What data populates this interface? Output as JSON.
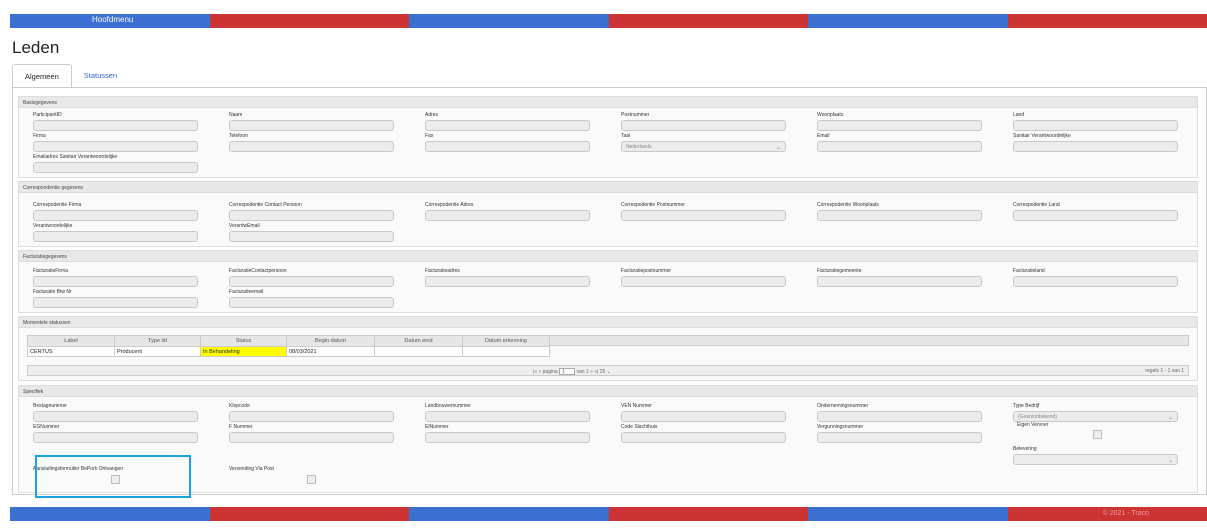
{
  "topbar": {
    "menu_label": "Hoofdmenu",
    "colors": [
      "#3b6fd1",
      "#cc3333"
    ]
  },
  "page": {
    "title": "Leden"
  },
  "tabs": [
    {
      "label": "Algemeen",
      "active": true
    },
    {
      "label": "Statussen",
      "active": false
    }
  ],
  "basis": {
    "header": "Basisgegevens",
    "fields": {
      "participant_id": "ParticipantID",
      "naam": "Naam",
      "adres": "Adres",
      "postnummer": "Postnummer",
      "woonplaats": "Woonplaats",
      "land": "Land",
      "firma": "Firma",
      "telefoon": "Telefoon",
      "fax": "Fax",
      "taal": "Taal",
      "taal_value": "Nederlands",
      "email": "Email",
      "sanitair": "Sanitair Verantwoordelijke",
      "emailadres_sanitair": "Emailadres Sanitair Verantwoordelijke"
    }
  },
  "correspondentie": {
    "header": "Correspondentie gegevens",
    "fields": {
      "firma": "Correspodentie Firma",
      "contact": "Correspodentie Contact Persoon",
      "adres": "Correspodentie Adres",
      "postnummer": "Correspodentie Postnummer",
      "woonplaats": "Correspodentie Woonplaats",
      "land": "Correspodentie Land",
      "verantwoordelijke": "Verantwoordelijke",
      "verant_email": "VerantwEmail"
    }
  },
  "facturatie": {
    "header": "Facturatiegegevens",
    "fields": {
      "firma": "FacturatieFirma",
      "contactpersoon": "FacturatieContactpersoon",
      "adres": "Facturatieadres",
      "postnummer": "Facturatiepostnummer",
      "gemeente": "Facturatiegemeente",
      "land": "Facturatieland",
      "btw": "Facturatie Btw Nr",
      "email": "Facturatieemail"
    }
  },
  "statussen": {
    "header": "Momentele statussen",
    "columns": [
      "Label",
      "Type lid",
      "Status",
      "Begin datum",
      "Datum eind",
      "Datum erkenning"
    ],
    "rows": [
      [
        "CERTUS",
        "Producent",
        "In Behandeling",
        "08/03/2021",
        "",
        ""
      ]
    ],
    "pager": {
      "pagina": "pagina",
      "page_value": "1",
      "van": "van 1",
      "page_size": "25",
      "records": "regels 1 - 1 van 1"
    }
  },
  "specifiek": {
    "header": "Specifiek",
    "fields": {
      "bestagnummer": "Bestagnummer",
      "klopcode": "Klopcode",
      "landbouwernummer": "Landbouwernummer",
      "vennummer": "VEN Nummer",
      "ondernemingsnummer": "Ondernemingsnummer",
      "type_bedrijf": "Type Bedrijf",
      "type_bedrijf_value": "(Geen/onbekend)",
      "egnummer": "EGNummer",
      "fnummer": "F Nummer",
      "elnummer": "ElNummer",
      "code_slachthuis": "Code Slachthuis",
      "vergunningsnummer": "Vergunningsnummer",
      "eigen_vervoer": "Eigen Vervoer",
      "belevering": "Belevering",
      "aansluiting": "Aansluitingsformulier BePork Ontvangen",
      "verzending": "Verzending Via Post"
    }
  },
  "footer": {
    "copyright": "© 2021 - Traco"
  }
}
